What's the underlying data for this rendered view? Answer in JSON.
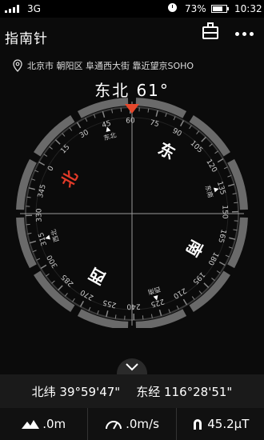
{
  "status": {
    "network": "3G",
    "battery": "73%",
    "battery_level": 0.73,
    "time": "10:32"
  },
  "app": {
    "title": "指南针"
  },
  "location": {
    "text": "北京市 朝阳区 阜通西大街 靠近望京SOHO"
  },
  "heading": {
    "text": "东北 61°",
    "degrees": 61
  },
  "dial": {
    "ticks": [
      "0",
      "15",
      "30",
      "45",
      "60",
      "75",
      "90",
      "105",
      "120",
      "135",
      "150",
      "165",
      "180",
      "195",
      "210",
      "225",
      "240",
      "255",
      "270",
      "285",
      "300",
      "315",
      "330",
      "345"
    ],
    "directions": [
      "北",
      "东",
      "南",
      "西"
    ],
    "intercardinals": [
      "东北",
      "东南",
      "西南",
      "西北"
    ],
    "north_color": "#e03a28",
    "marker_color": "#e5482c"
  },
  "coords": {
    "lat": "北纬 39°59'47\"",
    "lon": "东经 116°28'51\""
  },
  "metrics": {
    "altitude": ".0m",
    "speed": ".0m/s",
    "magnetic": "45.2μT"
  }
}
